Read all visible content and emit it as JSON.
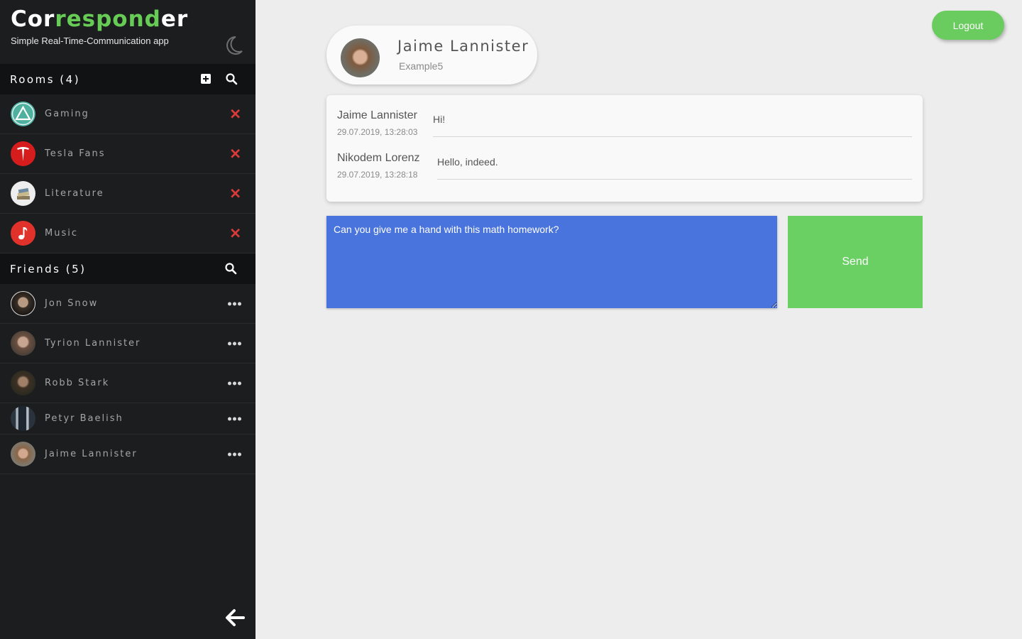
{
  "brand": {
    "title_part1": "Cor",
    "title_part2": "respond",
    "title_part3": "er",
    "subtitle": "Simple Real-Time-Communication app"
  },
  "rooms": {
    "header": "Rooms (4)",
    "items": [
      {
        "label": "Gaming",
        "icon": "triangle-icon",
        "color": "#4fb0a0"
      },
      {
        "label": "Tesla Fans",
        "icon": "tesla-icon",
        "color": "#d61d1d"
      },
      {
        "label": "Literature",
        "icon": "books-icon",
        "color": "#e8e8e8"
      },
      {
        "label": "Music",
        "icon": "music-note-icon",
        "color": "#e0322a"
      }
    ]
  },
  "friends": {
    "header": "Friends (5)",
    "items": [
      {
        "label": "Jon Snow"
      },
      {
        "label": "Tyrion Lannister"
      },
      {
        "label": "Robb Stark"
      },
      {
        "label": "Petyr Baelish"
      },
      {
        "label": "Jaime Lannister"
      }
    ]
  },
  "header": {
    "logout_label": "Logout"
  },
  "profile": {
    "name": "Jaime Lannister",
    "username": "Example5"
  },
  "messages": [
    {
      "author": "Jaime Lannister",
      "time": "29.07.2019, 13:28:03",
      "text": "Hi!"
    },
    {
      "author": "Nikodem Lorenz",
      "time": "29.07.2019, 13:28:18",
      "text": "Hello, indeed."
    }
  ],
  "compose": {
    "value": "Can you give me a hand with this math homework?",
    "send_label": "Send"
  },
  "colors": {
    "accent_green": "#6acc5e",
    "compose_blue": "#4a74dd",
    "sidebar_bg": "#1c1d1f",
    "delete_red": "#d93a3a"
  }
}
